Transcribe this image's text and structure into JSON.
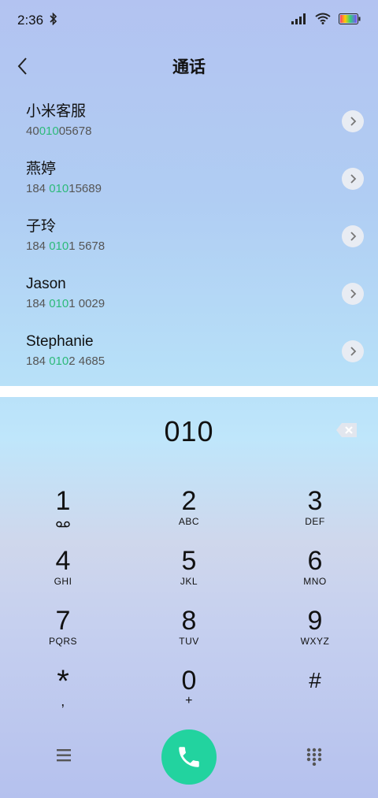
{
  "status": {
    "time": "2:36",
    "icons": [
      "bluetooth-icon",
      "signal-icon",
      "wifi-icon",
      "battery-icon"
    ]
  },
  "header": {
    "title": "通话"
  },
  "contacts": [
    {
      "name": "小米客服",
      "number_prefix": "40",
      "number_match": "010",
      "number_suffix": "05678"
    },
    {
      "name": "燕婷",
      "number_prefix": "184 ",
      "number_match": "010",
      "number_suffix": "15689"
    },
    {
      "name": "子玲",
      "number_prefix": "184 ",
      "number_match": "010",
      "number_suffix": "1 5678"
    },
    {
      "name": "Jason",
      "number_prefix": "184 ",
      "number_match": "010",
      "number_suffix": "1 0029"
    },
    {
      "name": "Stephanie",
      "number_prefix": "184 ",
      "number_match": "010",
      "number_suffix": "2 4685"
    }
  ],
  "dialer": {
    "value": "010",
    "keys": [
      [
        {
          "digit": "1",
          "letters": ""
        },
        {
          "digit": "2",
          "letters": "ABC"
        },
        {
          "digit": "3",
          "letters": "DEF"
        }
      ],
      [
        {
          "digit": "4",
          "letters": "GHI"
        },
        {
          "digit": "5",
          "letters": "JKL"
        },
        {
          "digit": "6",
          "letters": "MNO"
        }
      ],
      [
        {
          "digit": "7",
          "letters": "PQRS"
        },
        {
          "digit": "8",
          "letters": "TUV"
        },
        {
          "digit": "9",
          "letters": "WXYZ"
        }
      ],
      [
        {
          "digit": "*",
          "letters": ","
        },
        {
          "digit": "0",
          "letters": "+"
        },
        {
          "digit": "#",
          "letters": ""
        }
      ]
    ]
  },
  "colors": {
    "accent": "#2dba7a",
    "call_button": "#22d39f"
  }
}
